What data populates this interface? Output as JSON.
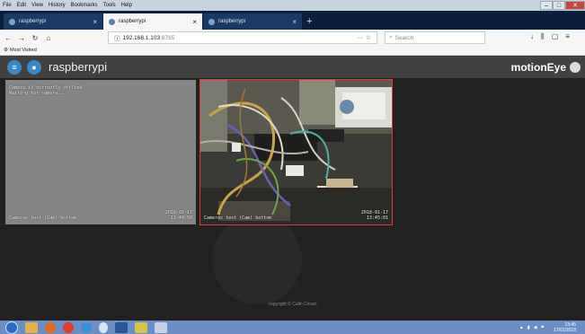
{
  "browser": {
    "menu": [
      "File",
      "Edit",
      "View",
      "History",
      "Bookmarks",
      "Tools",
      "Help"
    ],
    "tabs": [
      {
        "label": "raspberrypi",
        "active": false
      },
      {
        "label": "raspberrypi",
        "active": true
      },
      {
        "label": "raspberrypi",
        "active": false
      }
    ],
    "url": {
      "host": "192.168.1.103",
      "port": ":8765"
    },
    "url_actions": "··· ☆",
    "search_placeholder": "Search",
    "bookmarks": [
      "Most Visited"
    ]
  },
  "app": {
    "title": "raspberrypi",
    "brand": "motionEye",
    "colors": {
      "header": "#414141",
      "accent": "#3a88c6",
      "selected_frame": "#d93b3b"
    }
  },
  "cameras": [
    {
      "osd_top": "Camera is currently offline\nWaiting for camera...",
      "osd_bottom_left": "Cameras test (Cam) bottom",
      "osd_bottom_right": "2018-01-17\n13:44:50"
    },
    {
      "osd_bottom_left": "Cameras test (Cam) bottom",
      "osd_bottom_right": "2018-01-17\n13:45:01"
    }
  ],
  "footer": "copyright © Calin Crisan",
  "taskbar": {
    "clock_time": "13:45",
    "clock_date": "17/01/2018"
  }
}
